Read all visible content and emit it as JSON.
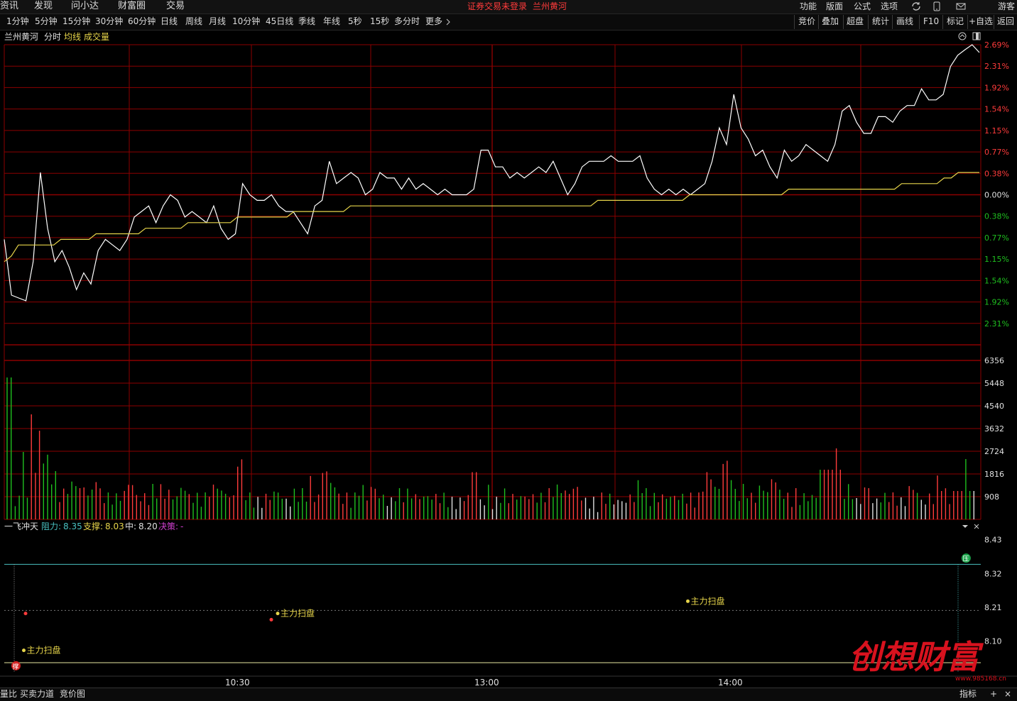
{
  "menu": {
    "left": [
      "资讯",
      "发现",
      "问小达",
      "财富圈",
      "交易"
    ],
    "login_notice": "证券交易未登录",
    "stock": "兰州黄河",
    "right": [
      "功能",
      "版面",
      "公式",
      "选项"
    ],
    "guest": "游客"
  },
  "periods": [
    "1分钟",
    "5分钟",
    "15分钟",
    "30分钟",
    "60分钟",
    "日线",
    "周线",
    "月线",
    "10分钟",
    "45日线",
    "季线",
    "年线",
    "5秒",
    "15秒",
    "多分时",
    "更多"
  ],
  "right_tools": [
    "竞价",
    "叠加",
    "超盘",
    "统计",
    "画线",
    "F10",
    "标记",
    "+自选",
    "返回"
  ],
  "chart_header": {
    "stock": "兰州黄河",
    "mode": "分时",
    "avg": "均线",
    "vol": "成交量"
  },
  "colors": {
    "grid": "#8b0000",
    "price": "#ffffff",
    "avg": "#e6d44a",
    "up": "#ff3b3b",
    "down": "#1fbf1f",
    "cyan": "#49c0c0"
  },
  "icons": [
    "sync-icon",
    "phone-icon",
    "mail-icon",
    "expand-icon",
    "maximize-icon",
    "dropdown-icon",
    "close-icon"
  ],
  "chart_data": {
    "type": "line",
    "price_axis_labels": [
      "2.69%",
      "2.31%",
      "1.92%",
      "1.54%",
      "1.15%",
      "0.77%",
      "0.38%",
      "0.00%",
      "0.38%",
      "0.77%",
      "1.15%",
      "1.54%",
      "1.92%",
      "2.31%"
    ],
    "ylim": [
      -2.69,
      2.69
    ],
    "time_labels": [
      "10:30",
      "13:00",
      "14:00"
    ],
    "series": [
      {
        "values": [
          -0.8,
          -1.8,
          -1.85,
          -1.9,
          -1.2,
          0.4,
          -0.6,
          -1.2,
          -1.0,
          -1.3,
          -1.7,
          -1.4,
          -1.6,
          -1.0,
          -0.8,
          -0.9,
          -1.0,
          -0.8,
          -0.4,
          -0.3,
          -0.2,
          -0.5,
          -0.2,
          0.0,
          -0.1,
          -0.4,
          -0.3,
          -0.4,
          -0.5,
          -0.2,
          -0.6,
          -0.8,
          -0.7,
          0.2,
          0.0,
          -0.1,
          -0.1,
          0.0,
          -0.2,
          -0.3,
          -0.3,
          -0.5,
          -0.7,
          -0.2,
          -0.1,
          0.6,
          0.2,
          0.3,
          0.4,
          0.3,
          0.0,
          0.1,
          0.4,
          0.3,
          0.3,
          0.1,
          0.3,
          0.1,
          0.2,
          0.1,
          0.0,
          0.1,
          0.0,
          0.0,
          0.0,
          0.1,
          0.8,
          0.8,
          0.5,
          0.5,
          0.3,
          0.4,
          0.3,
          0.4,
          0.5,
          0.4,
          0.6,
          0.3,
          0.0,
          0.2,
          0.5,
          0.6,
          0.6,
          0.6,
          0.7,
          0.6,
          0.6,
          0.6,
          0.7,
          0.3,
          0.1,
          0.0,
          0.1,
          0.0,
          0.1,
          0.0,
          0.1,
          0.2,
          0.6,
          1.2,
          0.9,
          1.8,
          1.2,
          1.0,
          0.7,
          0.8,
          0.5,
          0.3,
          0.8,
          0.6,
          0.7,
          0.9,
          0.8,
          0.7,
          0.6,
          0.9,
          1.5,
          1.6,
          1.3,
          1.1,
          1.1,
          1.4,
          1.4,
          1.3,
          1.5,
          1.6,
          1.6,
          1.9,
          1.7,
          1.7,
          1.8,
          2.3,
          2.5,
          2.6,
          2.69,
          2.55
        ]
      },
      {
        "values": [
          -1.2,
          -1.1,
          -0.9,
          -0.9,
          -0.9,
          -0.9,
          -0.9,
          -0.9,
          -0.8,
          -0.8,
          -0.8,
          -0.8,
          -0.8,
          -0.7,
          -0.7,
          -0.7,
          -0.7,
          -0.7,
          -0.7,
          -0.7,
          -0.6,
          -0.6,
          -0.6,
          -0.6,
          -0.6,
          -0.6,
          -0.5,
          -0.5,
          -0.5,
          -0.5,
          -0.5,
          -0.5,
          -0.5,
          -0.4,
          -0.4,
          -0.4,
          -0.4,
          -0.4,
          -0.4,
          -0.4,
          -0.4,
          -0.3,
          -0.3,
          -0.3,
          -0.3,
          -0.3,
          -0.3,
          -0.3,
          -0.3,
          -0.2,
          -0.2,
          -0.2,
          -0.2,
          -0.2,
          -0.2,
          -0.2,
          -0.2,
          -0.2,
          -0.2,
          -0.2,
          -0.2,
          -0.2,
          -0.2,
          -0.2,
          -0.2,
          -0.2,
          -0.2,
          -0.2,
          -0.2,
          -0.2,
          -0.2,
          -0.2,
          -0.2,
          -0.2,
          -0.2,
          -0.2,
          -0.2,
          -0.2,
          -0.2,
          -0.2,
          -0.2,
          -0.2,
          -0.2,
          -0.2,
          -0.1,
          -0.1,
          -0.1,
          -0.1,
          -0.1,
          -0.1,
          -0.1,
          -0.1,
          -0.1,
          -0.1,
          -0.1,
          -0.1,
          -0.1,
          0.0,
          0.0,
          0.0,
          0.0,
          0.0,
          0.0,
          0.0,
          0.0,
          0.0,
          0.0,
          0.0,
          0.0,
          0.0,
          0.0,
          0.1,
          0.1,
          0.1,
          0.1,
          0.1,
          0.1,
          0.1,
          0.1,
          0.1,
          0.1,
          0.1,
          0.1,
          0.1,
          0.1,
          0.1,
          0.1,
          0.2,
          0.2,
          0.2,
          0.2,
          0.2,
          0.2,
          0.3,
          0.3,
          0.4,
          0.4,
          0.4,
          0.4
        ]
      }
    ],
    "volume_axis_labels": [
      "6356",
      "5448",
      "4540",
      "3632",
      "2724",
      "1816",
      "908"
    ],
    "volume_max": 6356,
    "indicator": {
      "name": "一飞冲天",
      "resist_label": "阻力:",
      "resist": "8.35",
      "support_label": "支撑:",
      "support": "8.03",
      "mid_label": "中:",
      "mid": "8.20",
      "decision_label": "决策:",
      "decision": "-"
    },
    "indicator_axis_labels": [
      "8.43",
      "8.32",
      "8.21",
      "8.10"
    ],
    "indicator_ylim": [
      8.0,
      8.45
    ],
    "annotations": [
      {
        "text": "主力扫盘",
        "t": 0.02,
        "v": 8.07
      },
      {
        "text": "主力扫盘",
        "t": 0.28,
        "v": 8.19
      },
      {
        "text": "主力扫盘",
        "t": 0.7,
        "v": 8.23
      }
    ],
    "markers": [
      {
        "text": "压",
        "t": 0.985,
        "v": 8.37
      },
      {
        "text": "撑",
        "t": 0.012,
        "v": 8.02
      }
    ]
  },
  "bottom": {
    "tabs": [
      "量比",
      "买卖力道",
      "竞价图"
    ],
    "indicator_btn": "指标",
    "plus": "+",
    "close": "×"
  },
  "watermark": {
    "text": "创想财富",
    "url": "www.985168.cn"
  }
}
